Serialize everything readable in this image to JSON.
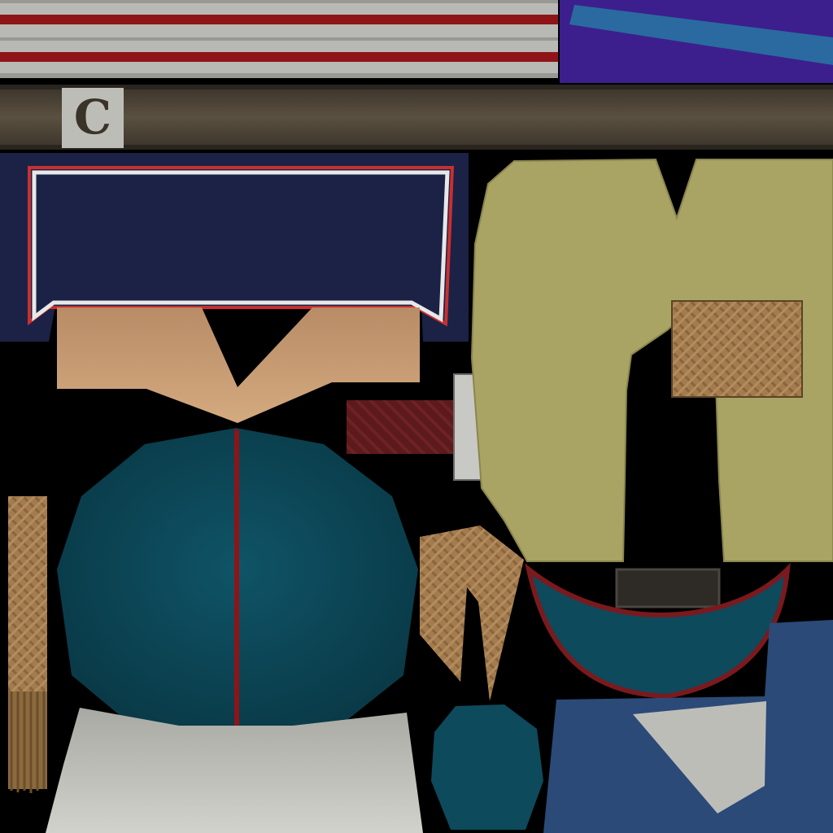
{
  "texture_atlas": {
    "belt_letter": "C",
    "colors": {
      "background": "#000000",
      "stripe_silver": "#b8b8b4",
      "stripe_red": "#8e1418",
      "purple_cloth": "#3c1f8c",
      "blue_band": "#2a6aa0",
      "belt_brown": "#4a4236",
      "navy_collar": "#1b2246",
      "skin": "#c49a72",
      "teal_fabric": "#0d4a5c",
      "olive_cloth": "#a9a463",
      "woven_brown": "#a27b4f",
      "cream_cloth": "#cdcdc6",
      "denim_blue": "#2b4a78",
      "dark_red_weave": "#5c1a1c",
      "emblem_dark": "#2b2b2b",
      "emblem_plate": "#c8c8c4"
    }
  }
}
